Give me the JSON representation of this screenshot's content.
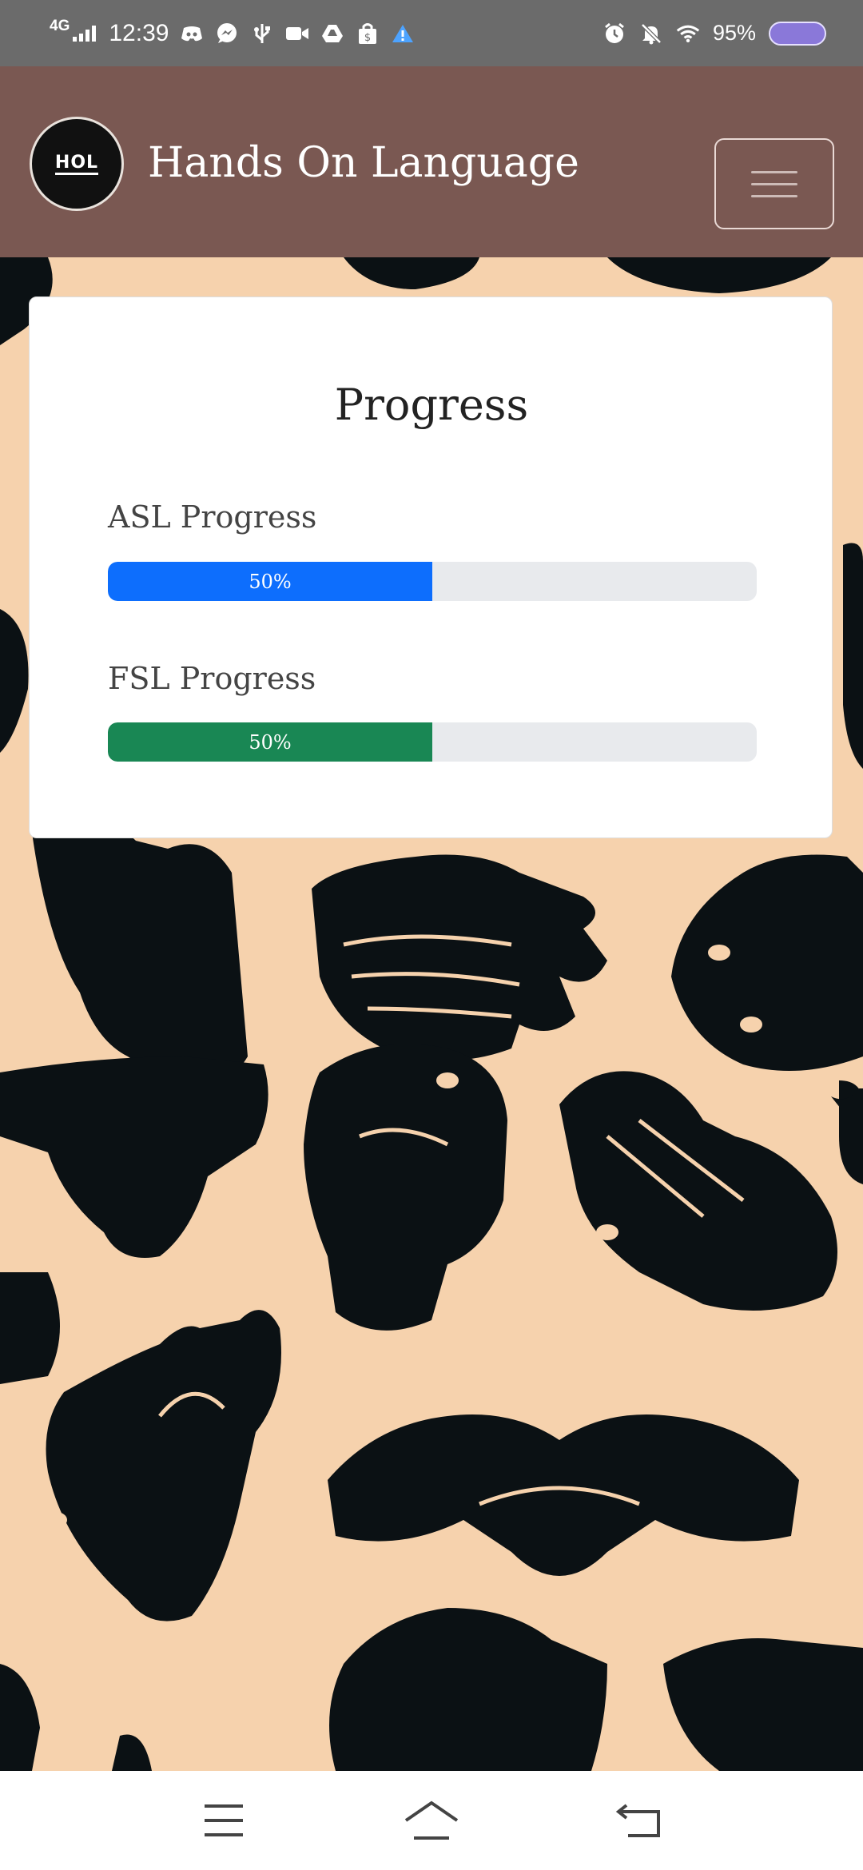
{
  "status_bar": {
    "network": "4G",
    "time": "12:39",
    "battery": "95%",
    "left_icons": [
      "discord-icon",
      "messenger-icon",
      "usb-icon",
      "video-icon",
      "drive-icon",
      "shopping-icon",
      "warning-icon"
    ],
    "right_icons": [
      "alarm-icon",
      "bell-muted-icon",
      "wifi-icon"
    ]
  },
  "header": {
    "logo_text": "HOL",
    "brand": "Hands On Language",
    "menu": "menu-toggle"
  },
  "card": {
    "title": "Progress",
    "items": [
      {
        "label": "ASL Progress",
        "value_text": "50%",
        "percent": 50,
        "color": "#0d6efd"
      },
      {
        "label": "FSL Progress",
        "value_text": "50%",
        "percent": 50,
        "color": "#198754"
      }
    ]
  },
  "colors": {
    "header_bg": "#7a5852",
    "page_bg": "#f6d2ad",
    "hand_color": "#0b1114"
  },
  "nav": {
    "items": [
      "menu-icon",
      "home-icon",
      "back-icon"
    ]
  }
}
